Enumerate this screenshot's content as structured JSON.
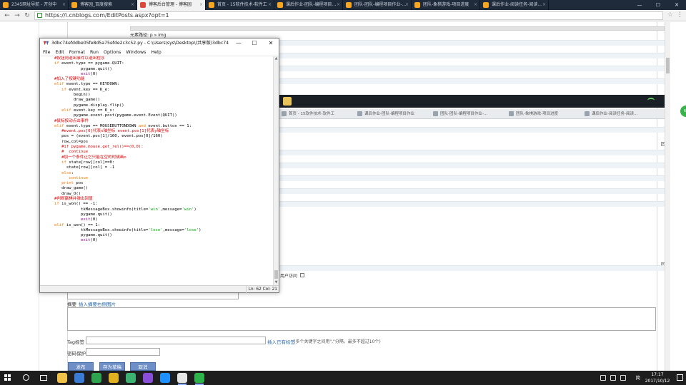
{
  "browser": {
    "tabs": [
      {
        "label": "2345网址导航 - 开创中"
      },
      {
        "label": "博客园_百度搜索"
      },
      {
        "label": "博客后台管理 - 博客园"
      },
      {
        "label": "首页 - 15软件技术-软件工"
      },
      {
        "label": "课后作业-团队-编程项目作业"
      },
      {
        "label": "团队-团队-编程项目作业-..."
      },
      {
        "label": "团队-象棋游戏-项目进度"
      },
      {
        "label": "课后作业-阅读任务-阅读..."
      }
    ],
    "active_tab": 2,
    "url": "https://i.cnblogs.com/EditPosts.aspx?opt=1",
    "window_controls": {
      "minimize": "—",
      "maximize": "☐",
      "close": "✕"
    }
  },
  "page": {
    "element_path": "元素路径: p » img",
    "visit_label": "用户访问",
    "summary_label": "摘要",
    "summary_link": "插入摘要右侧图片",
    "tag_label": "Tag标签",
    "tag_link": "插入已有标签",
    "tag_hint": "(多个关键字之间用\",\"分隔，最多不超过10个)",
    "password_label": "密码保护",
    "buttons": {
      "publish": "发布",
      "draft": "存为草稿",
      "cancel": "取消"
    },
    "embedded_tabs": [
      {
        "label": "首页 - 15软件技术-软件工"
      },
      {
        "label": "课后作业-团队-编程项目作业"
      },
      {
        "label": "团队-团队-编程项目作业-..."
      },
      {
        "label": "团队-象棋游戏-项目进度"
      },
      {
        "label": "课后作业-阅读任务-阅读..."
      }
    ],
    "orb_text": "66"
  },
  "idle": {
    "title": "3dbc74efddbe05fe8d5a75efde2c3c52.py - C:\\Users\\sys\\Desktop\\(共享版)3dbc74efdd...",
    "controls": {
      "minimize": "—",
      "maximize": "☐",
      "close": "✕"
    },
    "menu": [
      "File",
      "Edit",
      "Format",
      "Run",
      "Options",
      "Windows",
      "Help"
    ],
    "status": "Ln: 62 Col: 21",
    "lines": [
      {
        "i": 0,
        "segs": [
          {
            "t": "#按钮则退出事件以退出程序",
            "c": "cm"
          }
        ]
      },
      {
        "i": 0,
        "segs": [
          {
            "t": "if",
            "c": "kw"
          },
          {
            "t": " event.type == pygame.QUIT:",
            "c": ""
          }
        ]
      },
      {
        "i": 11,
        "segs": [
          {
            "t": "pygame.quit()",
            "c": ""
          }
        ]
      },
      {
        "i": 11,
        "segs": [
          {
            "t": "exit",
            "c": "bi"
          },
          {
            "t": "(0)",
            "c": ""
          }
        ]
      },
      {
        "i": 0,
        "segs": [
          {
            "t": "#加入了按键功能",
            "c": "cm"
          }
        ]
      },
      {
        "i": 0,
        "segs": [
          {
            "t": "elif",
            "c": "kw"
          },
          {
            "t": " event.type == KEYDOWN:",
            "c": ""
          }
        ]
      },
      {
        "i": 3,
        "segs": [
          {
            "t": "if",
            "c": "kw"
          },
          {
            "t": " event.key == K_e:",
            "c": ""
          }
        ]
      },
      {
        "i": 8,
        "segs": [
          {
            "t": "begin()",
            "c": ""
          }
        ]
      },
      {
        "i": 8,
        "segs": [
          {
            "t": "draw_game()",
            "c": ""
          }
        ]
      },
      {
        "i": 8,
        "segs": [
          {
            "t": "pygame.display.flip()",
            "c": ""
          }
        ]
      },
      {
        "i": 3,
        "segs": [
          {
            "t": "elif",
            "c": "kw"
          },
          {
            "t": " event.key == K_s:",
            "c": ""
          }
        ]
      },
      {
        "i": 8,
        "segs": [
          {
            "t": "pygame.event.post(pygame.event.Event(QUIT))",
            "c": ""
          }
        ]
      },
      {
        "i": 0,
        "segs": [
          {
            "t": "#鼠标按动点击事件",
            "c": "cm"
          }
        ]
      },
      {
        "i": 0,
        "segs": [
          {
            "t": "elif",
            "c": "kw"
          },
          {
            "t": " event.type == MOUSEBUTTONDOWN ",
            "c": ""
          },
          {
            "t": "and",
            "c": "kw"
          },
          {
            "t": " event.button == 1:",
            "c": ""
          }
        ]
      },
      {
        "i": 3,
        "segs": [
          {
            "t": "#event.pos[0]代表x轴坐标 event.pos[1]代表y轴坐标",
            "c": "cm"
          }
        ]
      },
      {
        "i": 3,
        "segs": [
          {
            "t": "pos = (event.pos[1]/160, event.pos[0]/160)",
            "c": ""
          }
        ]
      },
      {
        "i": 3,
        "segs": [
          {
            "t": "row,col=pos",
            "c": ""
          }
        ]
      },
      {
        "i": 3,
        "segs": [
          {
            "t": "#if pygame.mouse.get_rel()==(0,0):",
            "c": "cm"
          }
        ]
      },
      {
        "i": 3,
        "segs": [
          {
            "t": "#  continue",
            "c": "cm"
          }
        ]
      },
      {
        "i": 3,
        "segs": [
          {
            "t": "#加一个条件让它只能在空的时候画o",
            "c": "cm"
          }
        ]
      },
      {
        "i": 3,
        "segs": [
          {
            "t": "if",
            "c": "kw"
          },
          {
            "t": " state[row][col]==0:",
            "c": ""
          }
        ]
      },
      {
        "i": 5,
        "segs": [
          {
            "t": "state[row][col] = -1",
            "c": ""
          }
        ]
      },
      {
        "i": 3,
        "segs": [
          {
            "t": "else",
            "c": "kw"
          },
          {
            "t": ":",
            "c": ""
          }
        ]
      },
      {
        "i": 6,
        "segs": [
          {
            "t": "continue",
            "c": "kw"
          }
        ]
      },
      {
        "i": 3,
        "segs": [
          {
            "t": "print",
            "c": "kw"
          },
          {
            "t": " pos",
            "c": ""
          }
        ]
      },
      {
        "i": 3,
        "segs": [
          {
            "t": "draw_game()",
            "c": ""
          }
        ]
      },
      {
        "i": 3,
        "segs": [
          {
            "t": "draw_O()",
            "c": ""
          }
        ]
      },
      {
        "i": 0,
        "segs": [
          {
            "t": "#判断赢棋并弹出回值",
            "c": "cm"
          }
        ]
      },
      {
        "i": 0,
        "segs": [
          {
            "t": "if",
            "c": "kw"
          },
          {
            "t": " is_won() == -1:",
            "c": ""
          }
        ]
      },
      {
        "i": 11,
        "segs": [
          {
            "t": "tkMessageBox.showinfo(title=",
            "c": ""
          },
          {
            "t": "'win'",
            "c": "st"
          },
          {
            "t": ",message=",
            "c": ""
          },
          {
            "t": "'win'",
            "c": "st"
          },
          {
            "t": ")",
            "c": ""
          }
        ]
      },
      {
        "i": 11,
        "segs": [
          {
            "t": "pygame.quit()",
            "c": ""
          }
        ]
      },
      {
        "i": 11,
        "segs": [
          {
            "t": "exit",
            "c": "bi"
          },
          {
            "t": "(0)",
            "c": ""
          }
        ]
      },
      {
        "i": 0,
        "segs": [
          {
            "t": "elif",
            "c": "kw"
          },
          {
            "t": " is_won() == 1:",
            "c": ""
          }
        ]
      },
      {
        "i": 11,
        "segs": [
          {
            "t": "tkMessageBox.showinfo(title=",
            "c": ""
          },
          {
            "t": "'lose'",
            "c": "st"
          },
          {
            "t": ",message=",
            "c": ""
          },
          {
            "t": "'lose'",
            "c": "st"
          },
          {
            "t": ")",
            "c": ""
          }
        ]
      },
      {
        "i": 11,
        "segs": [
          {
            "t": "pygame.quit()",
            "c": ""
          }
        ]
      },
      {
        "i": 11,
        "segs": [
          {
            "t": "exit",
            "c": "bi"
          },
          {
            "t": "(0)",
            "c": ""
          }
        ]
      }
    ]
  },
  "taskbar": {
    "ime": "简体",
    "time": "17:17",
    "date": "2017/10/12",
    "apps": [
      {
        "name": "explorer",
        "color": "#f0c24a"
      },
      {
        "name": "browser-blue",
        "color": "#3a7bd5"
      },
      {
        "name": "browser-green",
        "color": "#2ea44f"
      },
      {
        "name": "chrome",
        "color": "#e0b020"
      },
      {
        "name": "wechat",
        "color": "#3cb371"
      },
      {
        "name": "gem",
        "color": "#8a4fd8"
      },
      {
        "name": "qq-browser",
        "color": "#1e90ff"
      },
      {
        "name": "idle",
        "color": "#e5e5e5"
      },
      {
        "name": "360",
        "color": "#2db34a"
      }
    ],
    "active_apps": [
      7,
      8
    ]
  },
  "colors": {
    "keyword": "#ff7700",
    "comment": "#dd0000",
    "string": "#00aa00",
    "builtin": "#900090",
    "button": "#6d8ec6",
    "link": "#2466a8"
  }
}
